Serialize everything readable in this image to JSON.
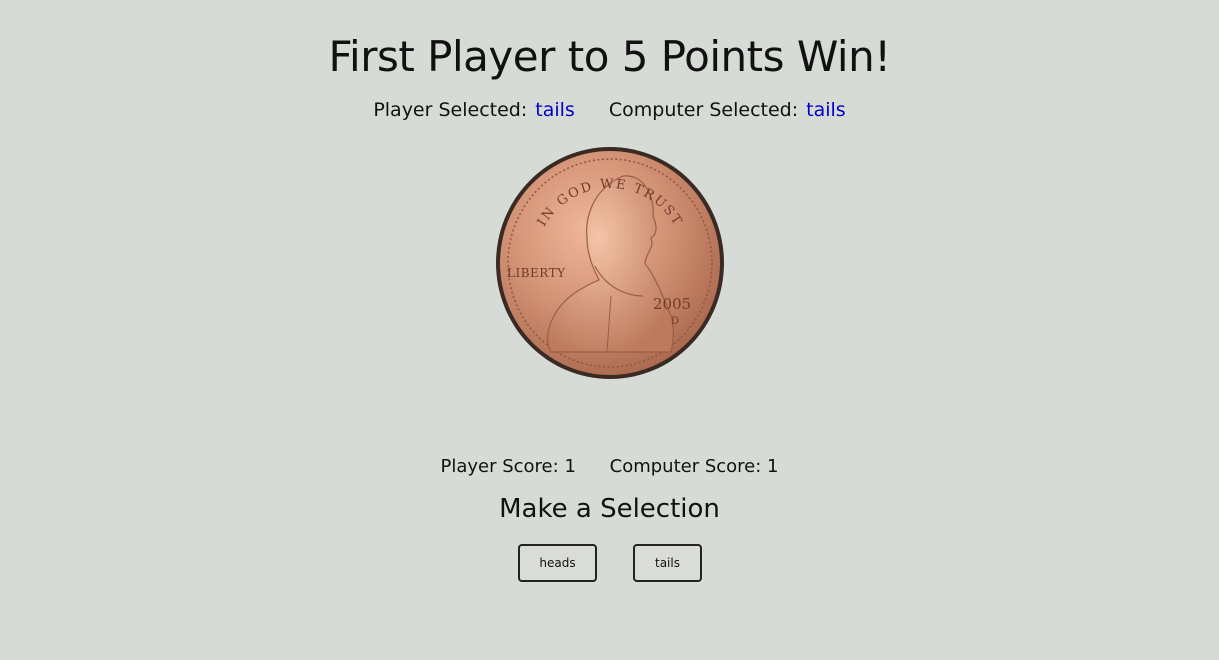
{
  "title": "First Player to 5 Points Win!",
  "selection": {
    "player_label": "Player Selected:",
    "player_value": "tails",
    "computer_label": "Computer Selected:",
    "computer_value": "tails"
  },
  "coin": {
    "motto": "IN GOD WE TRUST",
    "word": "LIBERTY",
    "year": "2005",
    "mint_mark": "D"
  },
  "scores": {
    "player_label": "Player Score:",
    "player_value": "1",
    "computer_label": "Computer Score:",
    "computer_value": "1"
  },
  "prompt": "Make a Selection",
  "buttons": {
    "heads": "heads",
    "tails": "tails"
  },
  "colors": {
    "background": "#d7dbd6",
    "selection_value": "#0000cc",
    "coin_copper": "#c9866a"
  }
}
